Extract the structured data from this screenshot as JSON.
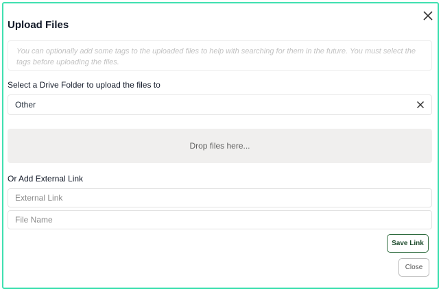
{
  "dialog": {
    "title": "Upload Files",
    "tags_hint": "You can optionally add some tags to the uploaded files to help with searching for them in the future. You must select the tags before uploading the files.",
    "folder_label": "Select a Drive Folder to upload the files to",
    "folder_value": "Other",
    "dropzone_text": "Drop files here...",
    "external_label": "Or Add External Link",
    "external_link_placeholder": "External Link",
    "file_name_placeholder": "File Name",
    "save_link_label": "Save Link",
    "close_label": "Close"
  },
  "icons": {
    "close": "close-icon",
    "clear": "clear-icon"
  },
  "colors": {
    "frame_border": "#3fe0b0",
    "save_border": "#2e6b3e",
    "dropzone_bg": "#f0efee"
  }
}
